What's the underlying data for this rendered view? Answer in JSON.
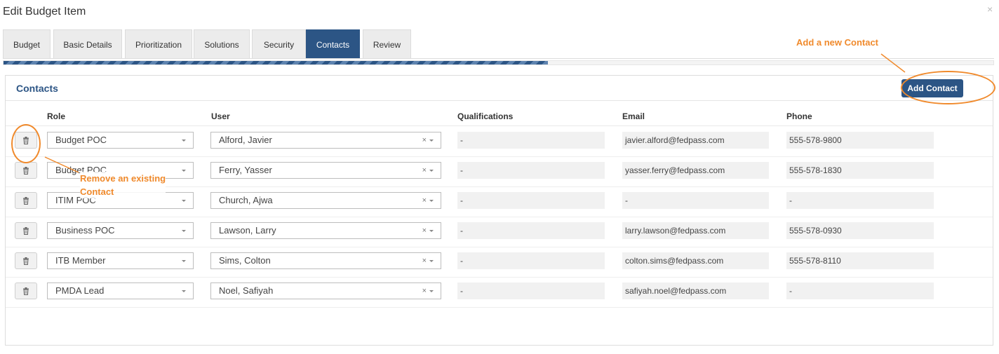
{
  "modal": {
    "title": "Edit Budget Item",
    "close": "×"
  },
  "tabs": [
    {
      "label": "Budget",
      "active": false
    },
    {
      "label": "Basic Details",
      "active": false
    },
    {
      "label": "Prioritization",
      "active": false
    },
    {
      "label": "Solutions",
      "active": false
    },
    {
      "label": "Security",
      "active": false
    },
    {
      "label": "Contacts",
      "active": true
    },
    {
      "label": "Review",
      "active": false
    }
  ],
  "progress": {
    "fraction": 0.55
  },
  "panel": {
    "title": "Contacts",
    "add_button": "Add Contact"
  },
  "columns": {
    "role": "Role",
    "user": "User",
    "qualifications": "Qualifications",
    "email": "Email",
    "phone": "Phone"
  },
  "rows": [
    {
      "role": "Budget POC",
      "user": "Alford, Javier",
      "qualifications": "-",
      "email": "javier.alford@fedpass.com",
      "phone": "555-578-9800"
    },
    {
      "role": "Budget POC",
      "user": "Ferry, Yasser",
      "qualifications": "-",
      "email": "yasser.ferry@fedpass.com",
      "phone": "555-578-1830"
    },
    {
      "role": "ITIM POC",
      "user": "Church, Ajwa",
      "qualifications": "-",
      "email": "-",
      "phone": "-"
    },
    {
      "role": "Business POC",
      "user": "Lawson, Larry",
      "qualifications": "-",
      "email": "larry.lawson@fedpass.com",
      "phone": "555-578-0930"
    },
    {
      "role": "ITB Member",
      "user": "Sims, Colton",
      "qualifications": "-",
      "email": "colton.sims@fedpass.com",
      "phone": "555-578-8110"
    },
    {
      "role": "PMDA Lead",
      "user": "Noel, Safiyah",
      "qualifications": "-",
      "email": "safiyah.noel@fedpass.com",
      "phone": "-"
    }
  ],
  "annotations": {
    "add_contact": "Add a new Contact",
    "remove_contact_line1": "Remove an existing",
    "remove_contact_line2": "Contact"
  },
  "colors": {
    "primary": "#2c5585",
    "annotation": "#f08a2c"
  }
}
